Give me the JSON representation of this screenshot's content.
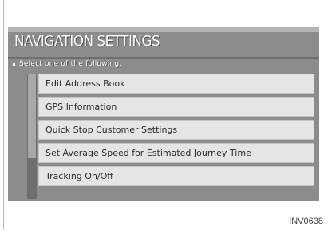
{
  "screen": {
    "title": "NAVIGATION SETTINGS",
    "instruction": "Select one of the following."
  },
  "menu": [
    {
      "label": "Edit Address Book"
    },
    {
      "label": "GPS Information"
    },
    {
      "label": "Quick Stop Customer Settings"
    },
    {
      "label": "Set Average Speed for Estimated Journey Time"
    },
    {
      "label": "Tracking On/Off"
    }
  ],
  "caption": "INV0638"
}
